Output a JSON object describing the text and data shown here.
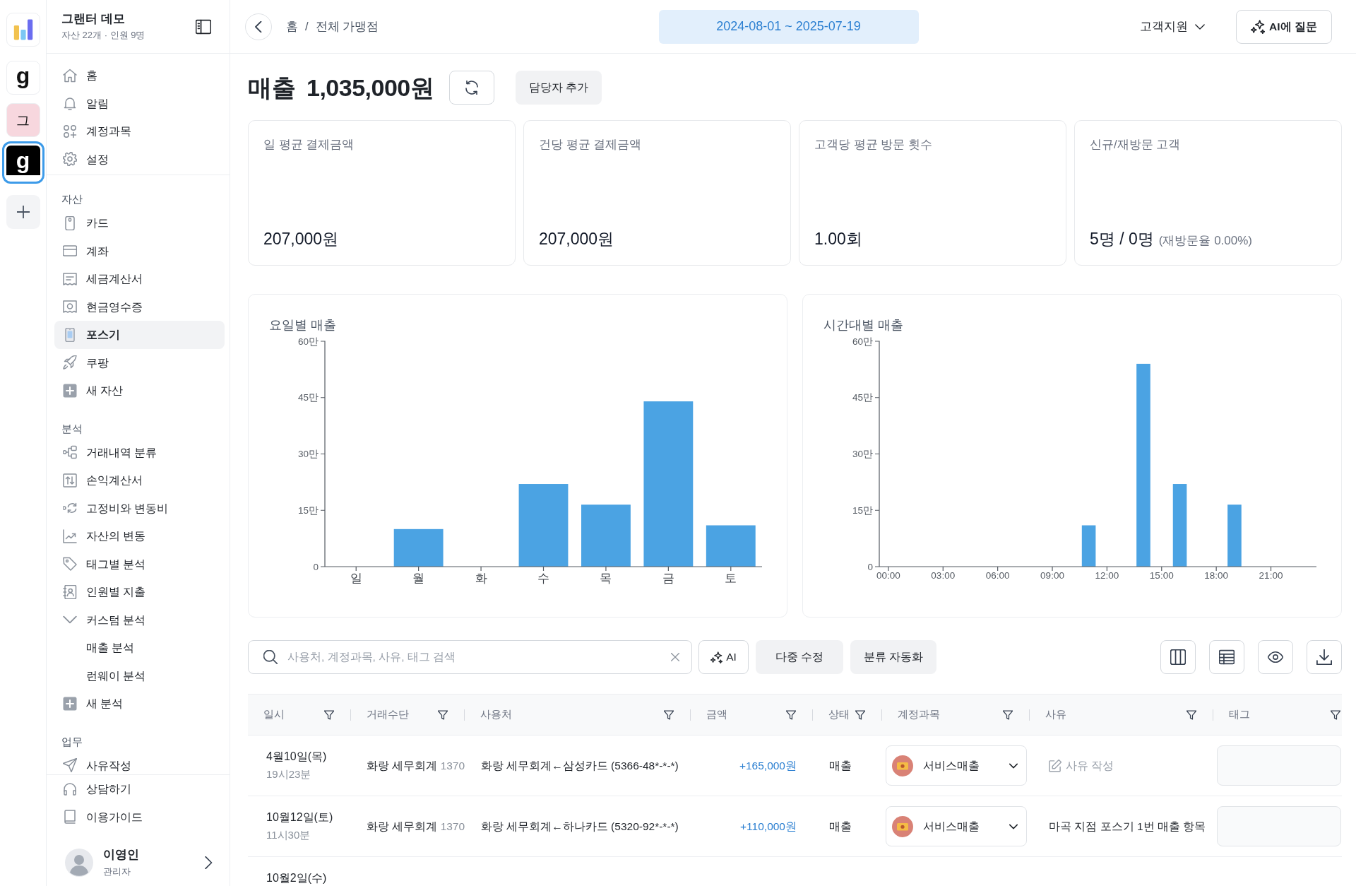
{
  "rail": {
    "workspaces": [
      {
        "label": "g",
        "color": "#ffffff",
        "selected": false
      },
      {
        "label": "그",
        "color": "#f7d7de",
        "selected": false
      },
      {
        "label": "g",
        "color": "#000000",
        "selected": true
      }
    ]
  },
  "sidebar": {
    "title": "그랜터 데모",
    "subtitle": "자산 22개 · 인원 9명",
    "top_items": [
      {
        "label": "홈",
        "selected": false
      },
      {
        "label": "알림",
        "selected": false
      },
      {
        "label": "계정과목",
        "selected": false
      },
      {
        "label": "설정",
        "selected": false
      }
    ],
    "sections": [
      {
        "heading": "자산",
        "items": [
          {
            "label": "카드",
            "selected": false
          },
          {
            "label": "계좌",
            "selected": false
          },
          {
            "label": "세금계산서",
            "selected": false
          },
          {
            "label": "현금영수증",
            "selected": false
          },
          {
            "label": "포스기",
            "selected": true
          },
          {
            "label": "쿠팡",
            "selected": false
          },
          {
            "label": "새 자산",
            "selected": false
          }
        ]
      },
      {
        "heading": "분석",
        "items": [
          {
            "label": "거래내역 분류",
            "selected": false
          },
          {
            "label": "손익계산서",
            "selected": false
          },
          {
            "label": "고정비와 변동비",
            "selected": false
          },
          {
            "label": "자산의 변동",
            "selected": false
          },
          {
            "label": "태그별 분석",
            "selected": false
          },
          {
            "label": "인원별 지출",
            "selected": false
          },
          {
            "label": "커스텀 분석",
            "selected": false,
            "expanded": true,
            "children": [
              {
                "label": "매출 분석",
                "selected": false
              },
              {
                "label": "런웨이 분석",
                "selected": false
              }
            ]
          },
          {
            "label": "새 분석",
            "selected": false
          }
        ]
      },
      {
        "heading": "업무",
        "items": [
          {
            "label": "사유작성",
            "selected": false
          }
        ]
      }
    ],
    "bottom_items": [
      {
        "label": "상담하기",
        "selected": false
      },
      {
        "label": "이용가이드",
        "selected": false
      }
    ],
    "user": {
      "name": "이영인",
      "role": "관리자"
    }
  },
  "topbar": {
    "breadcrumb": {
      "items": [
        "홈",
        "전체 가맹점"
      ],
      "separator": "/"
    },
    "date_range": "2024-08-01 ~ 2025-07-19",
    "support_menu": "고객지원",
    "ask_ai_button": "AI에 질문"
  },
  "page_header": {
    "title": "매출",
    "total": "1,035,000원",
    "assign_button": "담당자 추가"
  },
  "kpis": [
    {
      "label": "일 평균 결제금액",
      "value": "207,000원"
    },
    {
      "label": "건당 평균 결제금액",
      "value": "207,000원"
    },
    {
      "label": "고객당 평균 방문 횟수",
      "value": "1.00회"
    },
    {
      "label": "신규/재방문 고객",
      "value": "5명 / 0명",
      "note": "(재방문율 0.00%)"
    }
  ],
  "charts": [
    {
      "chart_data": {
        "type": "bar",
        "title": "요일별 매출",
        "categories": [
          "일",
          "월",
          "화",
          "수",
          "목",
          "금",
          "토"
        ],
        "values": [
          0,
          10,
          0,
          22,
          16.5,
          44,
          11
        ],
        "ylim": [
          0,
          60
        ],
        "yticks": [
          {
            "value": 0,
            "label": "0"
          },
          {
            "value": 15,
            "label": "15만"
          },
          {
            "value": 30,
            "label": "30만"
          },
          {
            "value": 45,
            "label": "45만"
          },
          {
            "value": 60,
            "label": "60만"
          }
        ]
      }
    },
    {
      "chart_data": {
        "type": "bar",
        "title": "시간대별 매출",
        "categories": [
          "00:00",
          null,
          null,
          "03:00",
          null,
          null,
          "06:00",
          null,
          null,
          "09:00",
          null,
          null,
          "12:00",
          null,
          null,
          "15:00",
          null,
          null,
          "18:00",
          null,
          null,
          "21:00",
          null,
          null
        ],
        "values": [
          0,
          0,
          0,
          0,
          0,
          0,
          0,
          0,
          0,
          0,
          0,
          11,
          0,
          0,
          54,
          0,
          22,
          0,
          0,
          16.5,
          0,
          0,
          0,
          0
        ],
        "ylim": [
          0,
          60
        ],
        "yticks": [
          {
            "value": 0,
            "label": "0"
          },
          {
            "value": 15,
            "label": "15만"
          },
          {
            "value": 30,
            "label": "30만"
          },
          {
            "value": 45,
            "label": "45만"
          },
          {
            "value": 60,
            "label": "60만"
          }
        ]
      }
    }
  ],
  "toolbar": {
    "search": {
      "placeholder": "사용처, 계정과목, 사유, 태그 검색"
    },
    "ai_button": "AI",
    "buttons": [
      "다중 수정",
      "분류 자동화"
    ]
  },
  "table": {
    "columns": [
      "일시",
      "거래수단",
      "사용처",
      "금액",
      "상태",
      "계정과목",
      "사유",
      "태그"
    ],
    "rows": [
      {
        "date": "4월10일(목)",
        "time": "19시23분",
        "method": "화랑 세무회계",
        "method_code": "1370",
        "merchant": "화랑 세무회계←삼성카드 (5366-48*-*-*)",
        "amount": "+165,000원",
        "status": "매출",
        "category": "서비스매출",
        "write_reason_button": "사유 작성"
      },
      {
        "date": "10월12일(토)",
        "time": "11시30분",
        "method": "화랑 세무회계",
        "method_code": "1370",
        "merchant": "화랑 세무회계←하나카드 (5320-92*-*-*)",
        "amount": "+110,000원",
        "status": "매출",
        "category": "서비스매출",
        "reason": "마곡 지점 포스기 1번 매출 항목"
      },
      {
        "date": "10월2일(수)"
      }
    ]
  }
}
